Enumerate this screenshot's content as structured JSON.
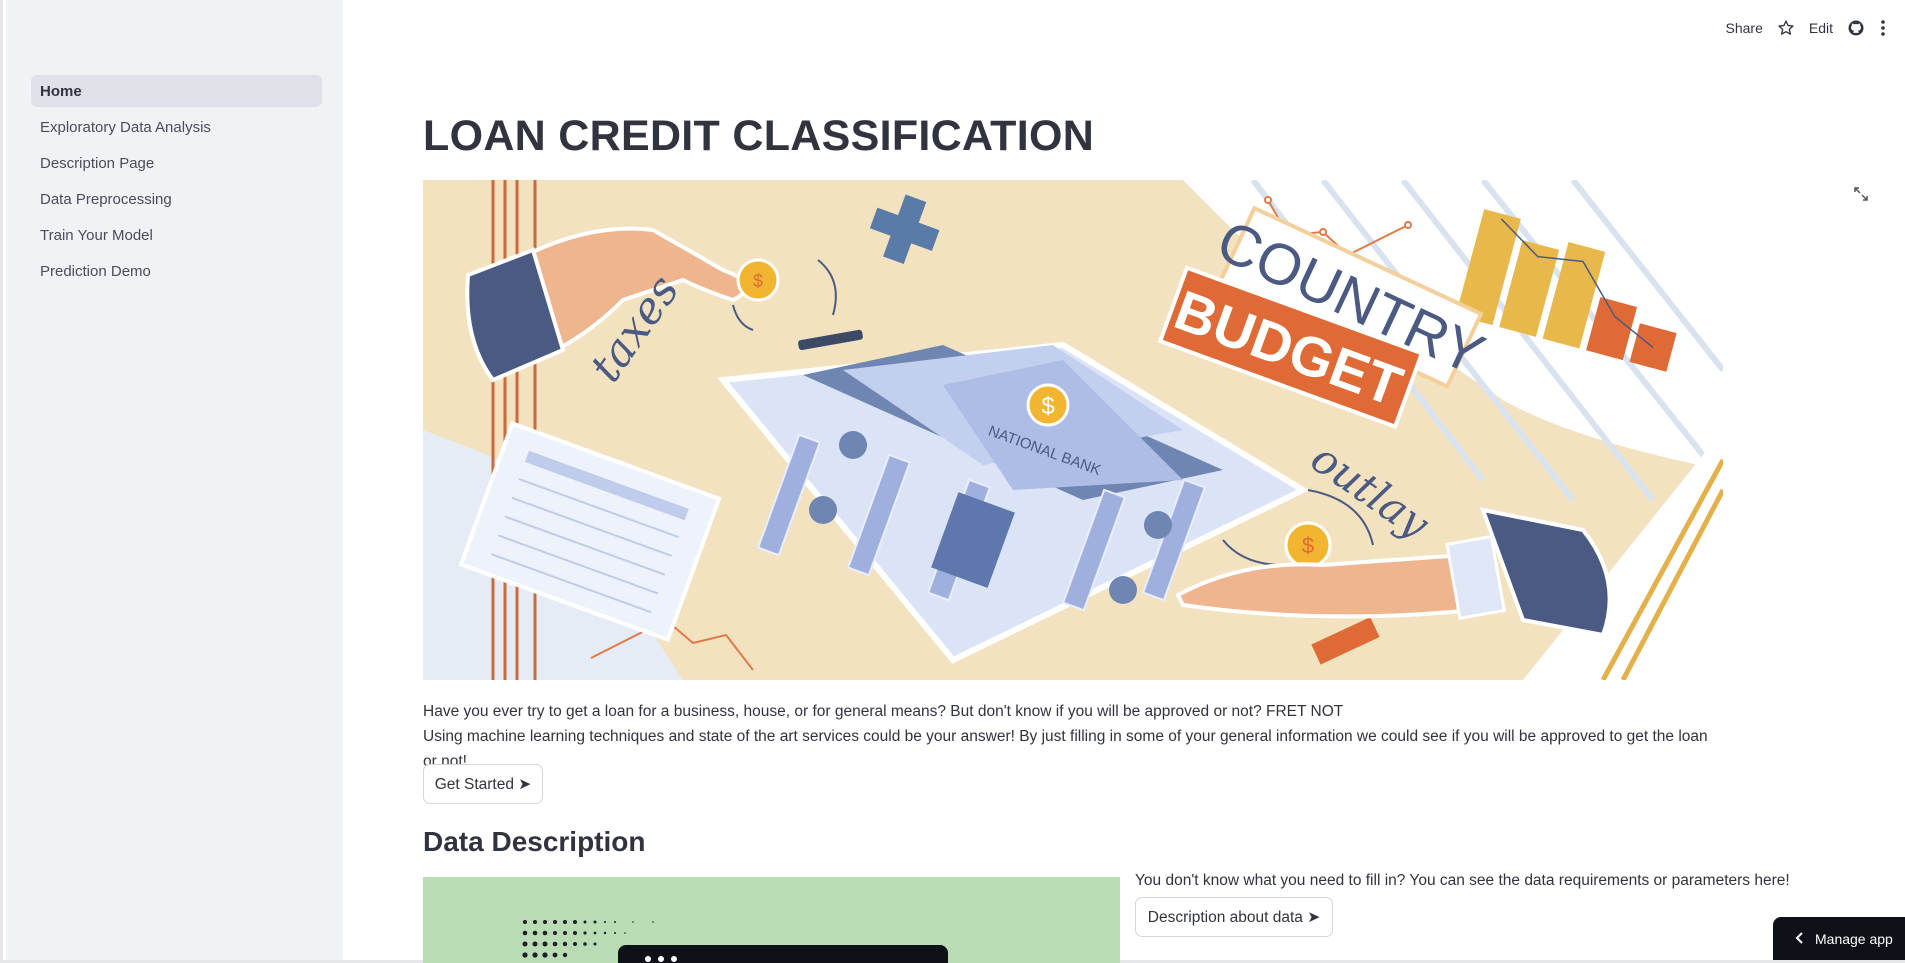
{
  "sidebar": {
    "items": [
      {
        "label": "Home",
        "active": true
      },
      {
        "label": "Exploratory Data Analysis"
      },
      {
        "label": "Description Page"
      },
      {
        "label": "Data Preprocessing"
      },
      {
        "label": "Train Your Model"
      },
      {
        "label": "Prediction Demo"
      }
    ]
  },
  "header": {
    "share_label": "Share",
    "star_icon": "star-icon",
    "edit_label": "Edit",
    "github_icon": "github-icon",
    "menu_icon": "more-vertical-icon"
  },
  "main": {
    "title": "LOAN CREDIT CLASSIFICATION",
    "hero": {
      "country_text": "COUNTRY",
      "budget_text": "BUDGET",
      "bank_text": "NATIONAL BANK",
      "taxes_text": "taxes",
      "outlay_text": "outlay",
      "coin_symbol": "$"
    },
    "intro_line1": "Have you ever try to get a loan for a business, house, or for general means? But don't know if you will be approved or not? FRET NOT",
    "intro_line2": "Using machine learning techniques and state of the art services could be your answer! By just filling in some of your general information we could see if you will be approved to get the loan or not!",
    "get_started_label": "Get Started ➤",
    "section_title": "Data Description",
    "data_req_text": "You don't know what you need to fill in? You can see the data requirements or parameters here!",
    "desc_button_label": "Description about data ➤"
  },
  "footer": {
    "manage_label": "Manage app"
  },
  "colors": {
    "sidebar_bg": "#f0f2f6",
    "active_item_bg": "#dfe1e8",
    "text": "#31333f",
    "hero_bg": "#f3e2bf",
    "accent_orange": "#e06a35",
    "accent_navy": "#4a5a82",
    "manage_bg": "#0e1117"
  }
}
